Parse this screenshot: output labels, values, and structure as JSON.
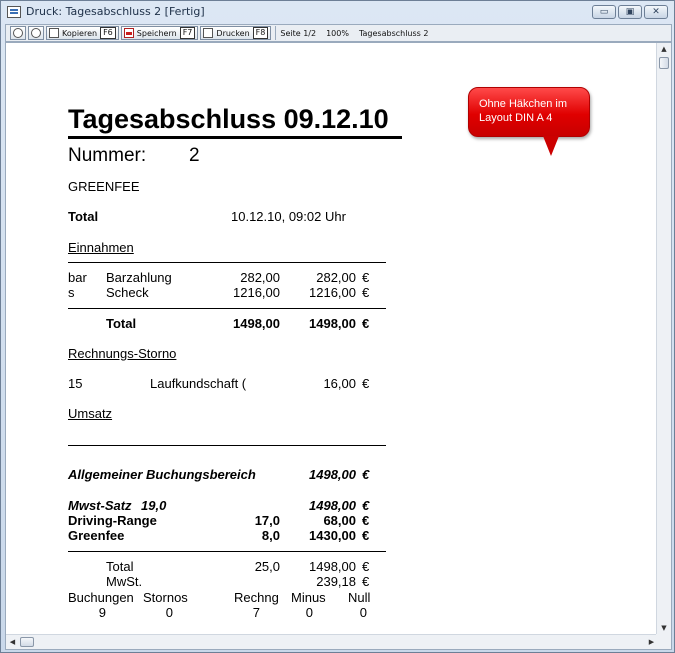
{
  "window": {
    "title": "Druck: Tagesabschluss 2 [Fertig]",
    "buttons": {
      "minimize": "▭",
      "maximize": "▣",
      "close": "✕"
    }
  },
  "toolbar": {
    "zoom_in_icon": "zoom-in-icon",
    "zoom_out_icon": "zoom-out-icon",
    "copy_label": "Kopieren",
    "copy_key": "F6",
    "save_label": "Speichern",
    "save_key": "F7",
    "print_label": "Drucken",
    "print_key": "F8",
    "page_info": "Seite 1/2",
    "zoom": "100%",
    "doc_name": "Tagesabschluss 2"
  },
  "report": {
    "title": "Tagesabschluss 09.12.10",
    "number_label": "Nummer:",
    "number_value": "2",
    "category": "GREENFEE",
    "total_label": "Total",
    "total_timestamp": "10.12.10, 09:02 Uhr",
    "section_income": "Einnahmen",
    "income_rows": [
      {
        "code": "bar",
        "name": "Barzahlung",
        "amount": "282,00",
        "total": "282,00",
        "cur": "€"
      },
      {
        "code": "s",
        "name": "Scheck",
        "amount": "1216,00",
        "total": "1216,00",
        "cur": "€"
      }
    ],
    "income_total": {
      "label": "Total",
      "amount": "1498,00",
      "total": "1498,00",
      "cur": "€"
    },
    "section_storno": "Rechnungs-Storno",
    "storno_row": {
      "nr": "15",
      "name": "Laufkundschaft (",
      "amount": "16,00",
      "cur": "€"
    },
    "section_umsatz": "Umsatz",
    "general_label": "Allgemeiner Buchungsbereich",
    "general_value": "1498,00",
    "general_cur": "€",
    "vat_label": "Mwst-Satz",
    "vat_rate": "19,0",
    "vat_value": "1498,00",
    "vat_cur": "€",
    "items": [
      {
        "name": "Driving-Range",
        "qty": "17,0",
        "amount": "68,00",
        "cur": "€"
      },
      {
        "name": "Greenfee",
        "qty": "8,0",
        "amount": "1430,00",
        "cur": "€"
      }
    ],
    "summary_total_label": "Total",
    "summary_total_qty": "25,0",
    "summary_total_amount": "1498,00",
    "summary_total_cur": "€",
    "summary_vat_label": "MwSt.",
    "summary_vat_amount": "239,18",
    "summary_vat_cur": "€",
    "stats_headers": [
      "Buchungen",
      "Stornos",
      "Rechng",
      "Minus",
      "Null"
    ],
    "stats_values": [
      "9",
      "0",
      "7",
      "0",
      "0"
    ]
  },
  "callout": {
    "line1": "Ohne Häkchen im",
    "line2": "Layout DIN A 4"
  },
  "colors": {
    "callout": "#e00000",
    "chrome": "#cfdbe8"
  }
}
